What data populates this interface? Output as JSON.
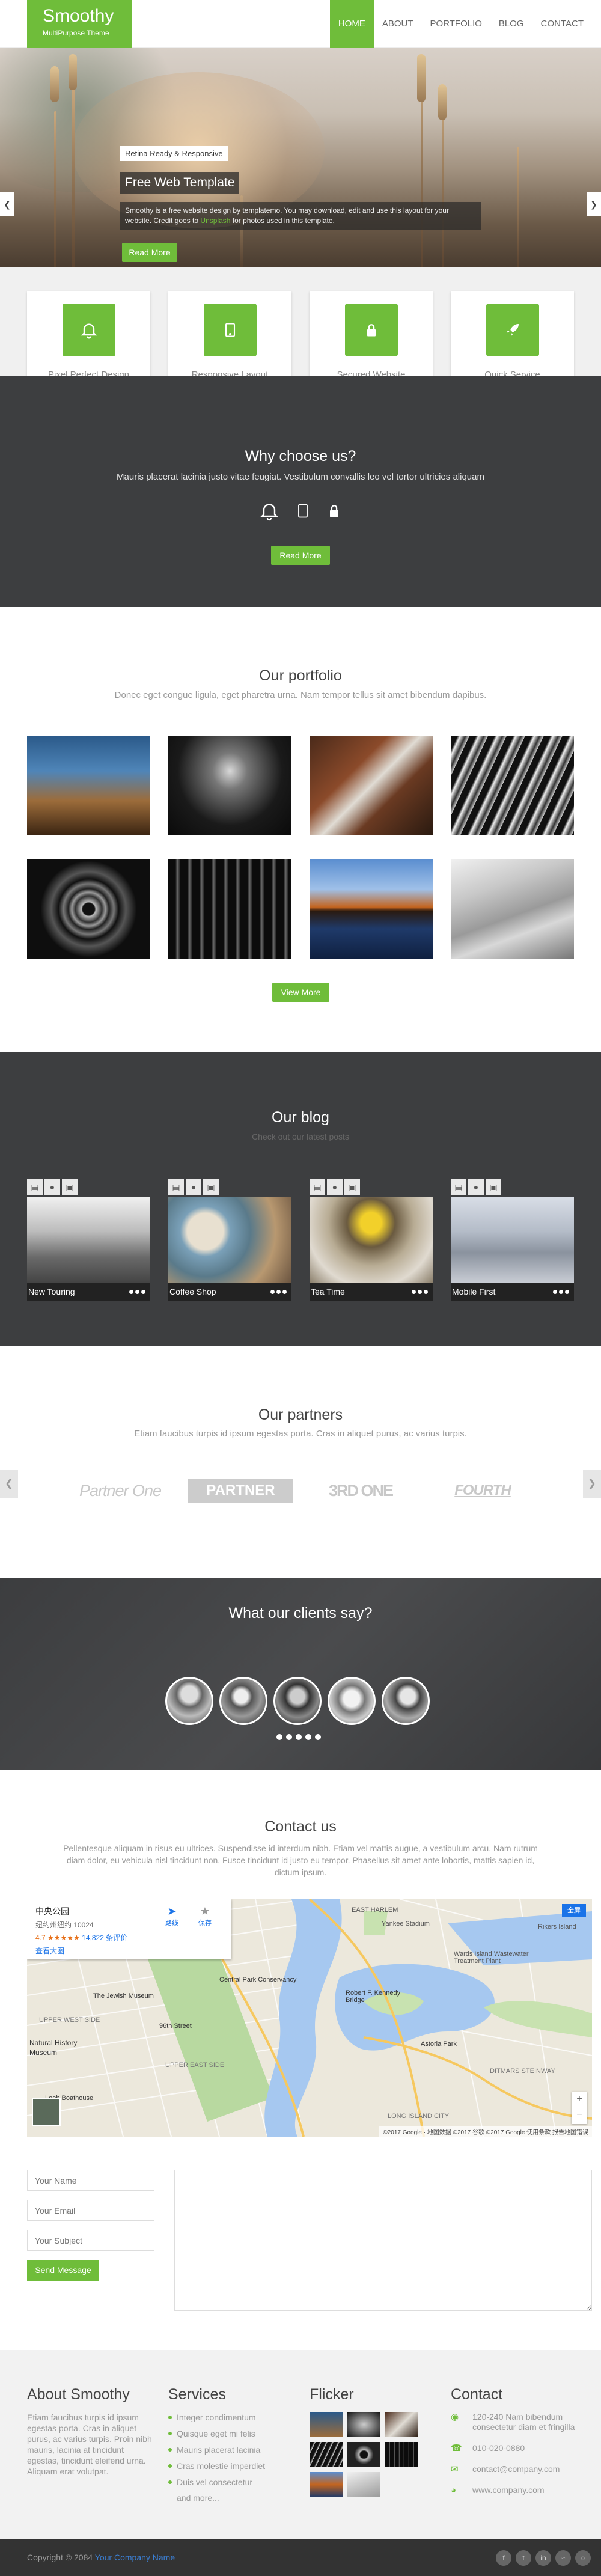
{
  "brand": {
    "name": "Smoothy",
    "tagline": "MultiPurpose Theme"
  },
  "nav": {
    "items": [
      "HOME",
      "ABOUT",
      "PORTFOLIO",
      "BLOG",
      "CONTACT"
    ],
    "active": "HOME"
  },
  "hero": {
    "tag": "Retina Ready & Responsive",
    "title": "Free Web Template",
    "desc_part1": "Smoothy is a free website design by templatemo. You may download, edit and use this layout for your website. Credit goes to ",
    "desc_link": "Unsplash",
    "desc_part2": " for photos used in this template.",
    "button": "Read More"
  },
  "features": [
    {
      "label": "Pixel Perfect Design",
      "icon": "bell-icon"
    },
    {
      "label": "Responsive Layout",
      "icon": "tablet-icon"
    },
    {
      "label": "Secured Website",
      "icon": "lock-icon"
    },
    {
      "label": "Quick Service",
      "icon": "rocket-icon"
    }
  ],
  "why": {
    "title": "Why choose us?",
    "text": "Mauris placerat lacinia justo vitae feugiat. Vestibulum convallis leo vel tortor ultricies aliquam",
    "button": "Read More"
  },
  "portfolio": {
    "title": "Our portfolio",
    "subtitle": "Donec eget congue ligula, eget pharetra urna. Nam tempor tellus sit amet bibendum dapibus.",
    "button": "View More"
  },
  "blog": {
    "title": "Our blog",
    "subtitle": "Check out our latest posts",
    "posts": [
      "New Touring",
      "Coffee Shop",
      "Tea Time",
      "Mobile First"
    ]
  },
  "partners": {
    "title": "Our partners",
    "subtitle": "Etiam faucibus turpis id ipsum egestas porta. Cras in aliquet purus, ac varius turpis.",
    "logos": [
      "Partner One",
      "PARTNER TWO",
      "3RD ONE",
      "FOURTH"
    ]
  },
  "clients": {
    "title": "What our clients say?"
  },
  "contact": {
    "title": "Contact us",
    "text": "Pellentesque aliquam in risus eu ultrices. Suspendisse id interdum nibh. Etiam vel mattis augue, a vestibulum arcu. Nam rutrum diam dolor, eu vehicula nisl tincidunt non. Fusce tincidunt id justo eu tempor. Phasellus sit amet ante lobortis, mattis sapien id, dictum ipsum.",
    "placeholders": {
      "name": "Your Name",
      "email": "Your Email",
      "subject": "Your Subject"
    },
    "button": "Send Message",
    "map": {
      "place_name": "中央公园",
      "address": "纽约州纽约 10024",
      "rating": "4.7",
      "reviews": "14,822 条评价",
      "larger_map": "查看大图",
      "directions": "路线",
      "save": "保存",
      "labels": [
        "EAST HARLEM",
        "Yankee Stadium",
        "Wards Island Wastewater Treatment Plant",
        "Central Park Conservancy",
        "The Jewish Museum",
        "Robert F. Kennedy Bridge",
        "UPPER WEST SIDE",
        "UPPER EAST SIDE",
        "96th Street",
        "Astoria Park",
        "DITMARS STEINWAY",
        "Rikers Island",
        "Natural History",
        "Museum",
        "Loeb Boathouse",
        "LONG ISLAND CITY"
      ],
      "footer": "©2017 Google · 地图数据 ©2017 谷歌 ©2017 Google 使用条款 报告地图错误",
      "fullscreen": "全屏"
    }
  },
  "footer": {
    "about": {
      "title": "About Smoothy",
      "text": "Etiam faucibus turpis id ipsum egestas porta. Cras in aliquet purus, ac varius turpis. Proin nibh mauris, lacinia at tincidunt egestas, tincidunt eleifend urna. Aliquam erat volutpat."
    },
    "services": {
      "title": "Services",
      "items": [
        "Integer condimentum",
        "Quisque eget mi felis",
        "Mauris placerat lacinia",
        "Cras molestie imperdiet",
        "Duis vel consectetur",
        "and more..."
      ]
    },
    "flicker": {
      "title": "Flicker"
    },
    "contact": {
      "title": "Contact",
      "address": "120-240 Nam bibendum consectetur diam et fringilla",
      "phone": "010-020-0880",
      "email": "contact@company.com",
      "web": "www.company.com"
    }
  },
  "copyright": {
    "prefix": "Copyright © 2084 ",
    "company": "Your Company Name"
  },
  "colors": {
    "accent": "#6fbd3a",
    "dark": "#3d3e40"
  }
}
